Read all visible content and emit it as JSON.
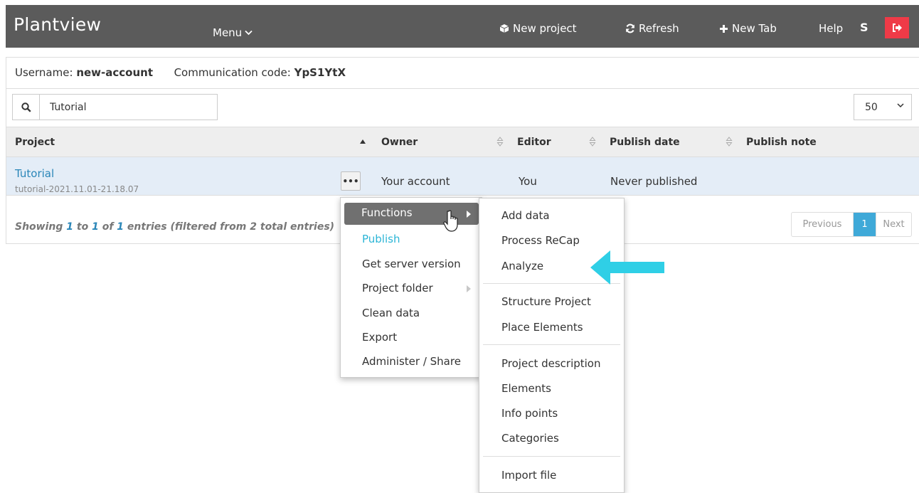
{
  "topbar": {
    "brand": "Plantview",
    "menu_label": "Menu",
    "new_project": "New project",
    "refresh": "Refresh",
    "new_tab": "New Tab",
    "help": "Help",
    "user_initial": "S"
  },
  "account": {
    "username_label": "Username:",
    "username": "new-account",
    "comm_label": "Communication code:",
    "comm_code": "YpS1YtX"
  },
  "search": {
    "value": "Tutorial"
  },
  "page_size": "50",
  "table": {
    "headers": {
      "project": "Project",
      "owner": "Owner",
      "editor": "Editor",
      "publish_date": "Publish date",
      "publish_note": "Publish note"
    },
    "rows": [
      {
        "name": "Tutorial",
        "id": "tutorial-2021.11.01-21.18.07",
        "owner": "Your account",
        "editor": "You",
        "publish_date": "Never published",
        "publish_note": ""
      }
    ]
  },
  "footer": {
    "showing": "Showing",
    "from": "1",
    "to_word": "to",
    "to": "1",
    "of_word": "of",
    "total": "1",
    "suffix": "entries (filtered from 2 total entries)"
  },
  "pager": {
    "previous": "Previous",
    "current": "1",
    "next": "Next"
  },
  "context_menu": {
    "items": [
      "Functions",
      "Publish",
      "Get server version",
      "Project folder",
      "Clean data",
      "Export",
      "Administer / Share"
    ]
  },
  "submenu": {
    "items": [
      "Add data",
      "Process ReCap",
      "Analyze",
      "Structure Project",
      "Place Elements",
      "Project description",
      "Elements",
      "Info points",
      "Categories",
      "Import file"
    ]
  },
  "colors": {
    "topbar": "#5b5b5b",
    "logout": "#ef3a47",
    "link": "#2a86b8",
    "accent": "#3fa9d8",
    "arrow": "#2fcfe6",
    "row_highlight": "#e4edf7"
  }
}
